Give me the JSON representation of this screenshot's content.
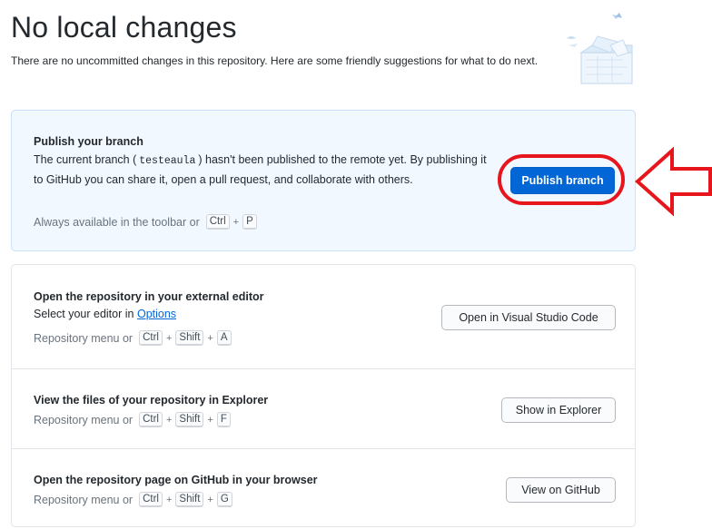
{
  "header": {
    "title": "No local changes",
    "subtitle": "There are no uncommitted changes in this repository. Here are some friendly suggestions for what to do next."
  },
  "publish": {
    "title": "Publish your branch",
    "desc_prefix": "The current branch (",
    "branch": "testeaula",
    "desc_suffix": ") hasn't been published to the remote yet. By publishing it to GitHub you can share it, open a pull request, and collaborate with others.",
    "hint": "Always available in the toolbar or",
    "keys": [
      "Ctrl",
      "P"
    ],
    "button": "Publish branch"
  },
  "editor": {
    "title": "Open the repository in your external editor",
    "desc_prefix": "Select your editor in",
    "link": "Options",
    "hint": "Repository menu or",
    "keys": [
      "Ctrl",
      "Shift",
      "A"
    ],
    "button": "Open in Visual Studio Code"
  },
  "explorer": {
    "title": "View the files of your repository in Explorer",
    "hint": "Repository menu or",
    "keys": [
      "Ctrl",
      "Shift",
      "F"
    ],
    "button": "Show in Explorer"
  },
  "github": {
    "title": "Open the repository page on GitHub in your browser",
    "hint": "Repository menu or",
    "keys": [
      "Ctrl",
      "Shift",
      "G"
    ],
    "button": "View on GitHub"
  },
  "plus_sign": "+",
  "colors": {
    "accent": "#0366d6",
    "annotation_red": "#e6161c",
    "publish_bg": "#f1f8ff"
  },
  "icons": {
    "illustration": "empty-state-illustration",
    "arrow": "red-arrow-annotation"
  }
}
